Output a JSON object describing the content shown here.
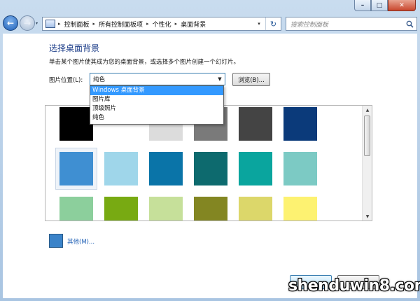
{
  "window": {
    "minimize_glyph": "–",
    "maximize_glyph": "□",
    "close_glyph": "✕"
  },
  "nav": {
    "back_glyph": "←",
    "forward_glyph": "→",
    "history_glyph": "▾"
  },
  "address": {
    "crumbs": [
      "控制面板",
      "所有控制面板项",
      "个性化",
      "桌面背景"
    ],
    "separator": "▸",
    "dropdown_glyph": "▾",
    "refresh_glyph": "↻"
  },
  "search": {
    "placeholder": "搜索控制面板"
  },
  "page": {
    "title": "选择桌面背景",
    "description": "单击某个图片使其成为您的桌面背景，或选择多个图片创建一个幻灯片。",
    "location_label": "图片位置(L):",
    "location_value": "纯色",
    "select_arrow_glyph": "▼",
    "browse_label": "浏览(B)...",
    "location_options": [
      {
        "label": "Windows 桌面背景",
        "highlighted": true
      },
      {
        "label": "图片库",
        "highlighted": false
      },
      {
        "label": "顶级照片",
        "highlighted": false
      },
      {
        "label": "纯色",
        "highlighted": false
      }
    ],
    "other_color_label": "其他(M)...",
    "other_color": "#3a83c9"
  },
  "swatches": [
    [
      "#000000",
      "#ffffff",
      "#dcdcdc",
      "#7a7a7a",
      "#444444",
      "#0b3a7a"
    ],
    [
      "#3f8fd2",
      "#9fd6ea",
      "#0a74a8",
      "#0d6a6e",
      "#0aa59e",
      "#7ccac4"
    ],
    [
      "#8ccf9c",
      "#78aa12",
      "#c6e09a",
      "#838622",
      "#dcd76a",
      "#fdf271"
    ]
  ],
  "scrollbar": {
    "up_glyph": "▲",
    "down_glyph": "▼"
  },
  "watermark": "shenduwin8.com"
}
